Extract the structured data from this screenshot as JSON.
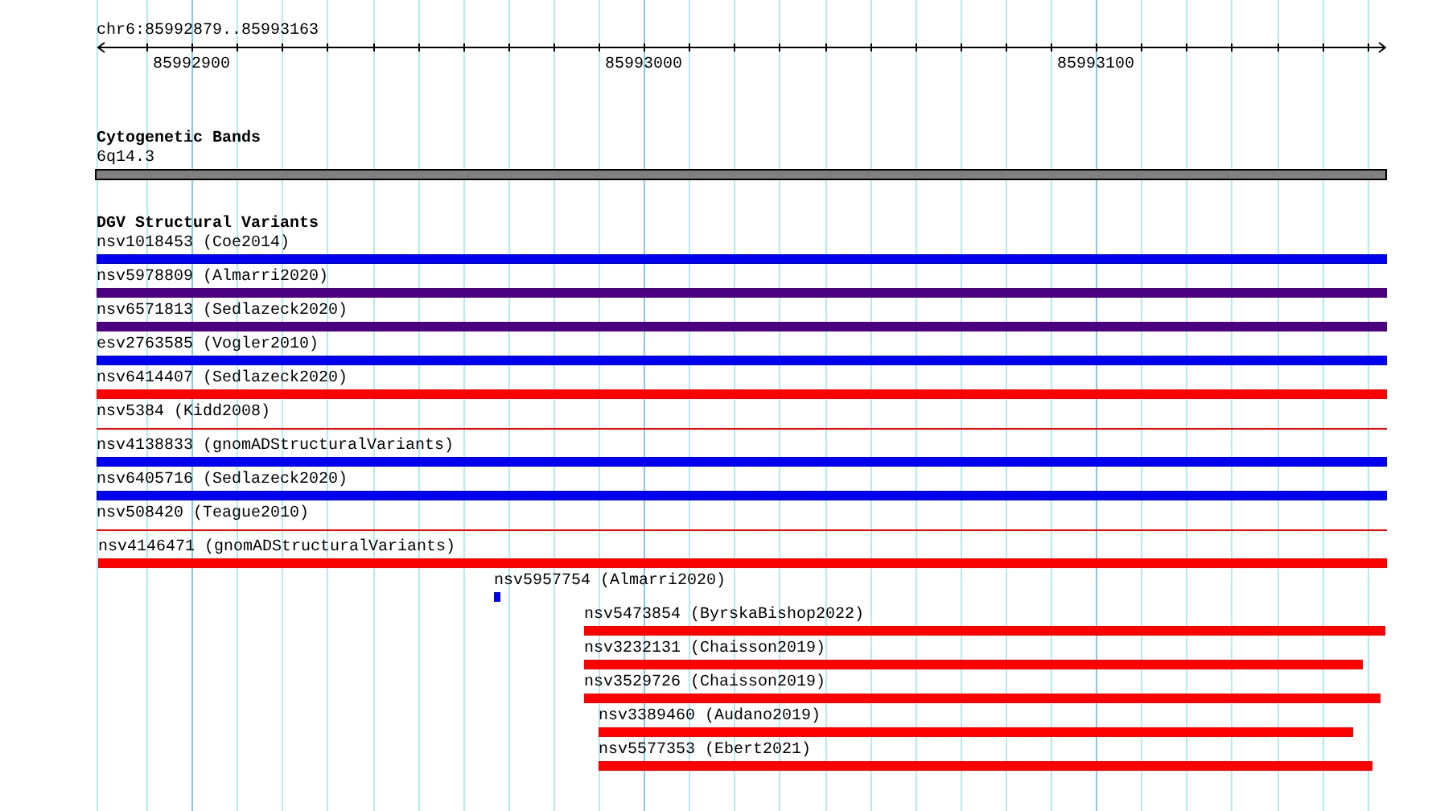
{
  "ruler": {
    "position": "chr6:85992879..85993163",
    "ticks": [
      "85992900",
      "85993000",
      "85993100"
    ]
  },
  "cytogenetic_bands": {
    "title": "Cytogenetic Bands",
    "band": "6q14.3"
  },
  "dgv": {
    "title": "DGV Structural Variants",
    "variants": [
      {
        "label": "nsv1018453 (Coe2014)",
        "kind": "bar",
        "color": "#0000ee"
      },
      {
        "label": "nsv5978809 (Almarri2020)",
        "kind": "bar",
        "color": "#4b0082"
      },
      {
        "label": "nsv6571813 (Sedlazeck2020)",
        "kind": "bar",
        "color": "#4b0082"
      },
      {
        "label": "esv2763585 (Vogler2010)",
        "kind": "bar",
        "color": "#0000ee"
      },
      {
        "label": "nsv6414407 (Sedlazeck2020)",
        "kind": "bar",
        "color": "#ff0000"
      },
      {
        "label": "nsv5384 (Kidd2008)",
        "kind": "line",
        "color": "#ff0000"
      },
      {
        "label": "nsv4138833 (gnomADStructuralVariants)",
        "kind": "bar",
        "color": "#0000ee"
      },
      {
        "label": "nsv6405716 (Sedlazeck2020)",
        "kind": "bar",
        "color": "#0000ee"
      },
      {
        "label": "nsv508420 (Teague2010)",
        "kind": "line",
        "color": "#ff0000"
      },
      {
        "label": "nsv4146471 (gnomADStructuralVariants)",
        "kind": "bar",
        "color": "#ff0000"
      },
      {
        "label": "nsv5957754 (Almarri2020)",
        "kind": "bar",
        "color": "#0000ee"
      },
      {
        "label": "nsv5473854 (ByrskaBishop2022)",
        "kind": "bar",
        "color": "#ff0000"
      },
      {
        "label": "nsv3232131 (Chaisson2019)",
        "kind": "bar",
        "color": "#ff0000"
      },
      {
        "label": "nsv3529726 (Chaisson2019)",
        "kind": "bar",
        "color": "#ff0000"
      },
      {
        "label": "nsv3389460 (Audano2019)",
        "kind": "bar",
        "color": "#ff0000"
      },
      {
        "label": "nsv5577353 (Ebert2021)",
        "kind": "bar",
        "color": "#ff0000"
      }
    ]
  }
}
